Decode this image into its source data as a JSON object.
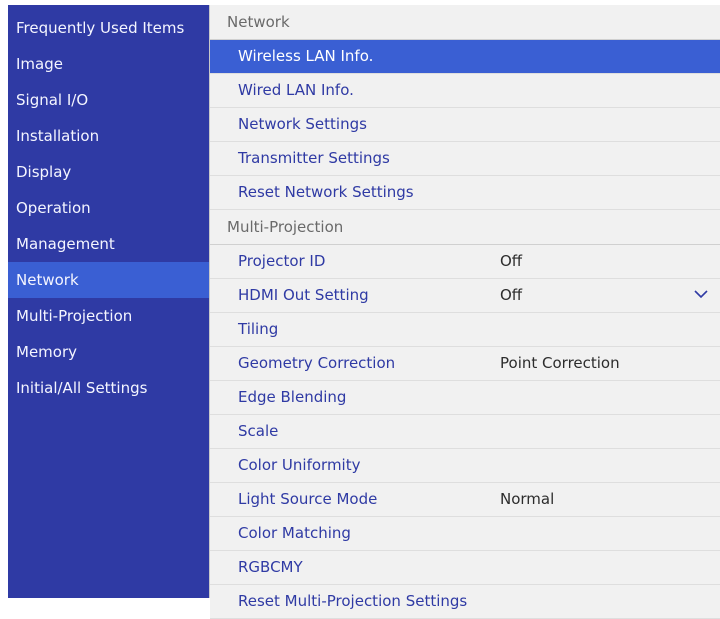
{
  "colors": {
    "sidebar_bg": "#2f3aa4",
    "highlight": "#3a5fd3",
    "item_text": "#2f3aa4",
    "value_text": "#2c2c2c",
    "section_text": "#6a6a6a"
  },
  "sidebar": {
    "items": [
      {
        "label": "Frequently Used Items"
      },
      {
        "label": "Image"
      },
      {
        "label": "Signal I/O"
      },
      {
        "label": "Installation"
      },
      {
        "label": "Display"
      },
      {
        "label": "Operation"
      },
      {
        "label": "Management"
      },
      {
        "label": "Network",
        "selected": true
      },
      {
        "label": "Multi-Projection"
      },
      {
        "label": "Memory"
      },
      {
        "label": "Initial/All Settings"
      }
    ]
  },
  "network": {
    "title": "Network",
    "items": [
      {
        "label": "Wireless LAN Info.",
        "selected": true
      },
      {
        "label": "Wired LAN Info."
      },
      {
        "label": "Network Settings"
      },
      {
        "label": "Transmitter Settings"
      },
      {
        "label": "Reset Network Settings"
      }
    ]
  },
  "multi_projection": {
    "title": "Multi-Projection",
    "items": [
      {
        "label": "Projector ID",
        "value": "Off"
      },
      {
        "label": "HDMI Out Setting",
        "value": "Off",
        "icon": "chevron-down-icon"
      },
      {
        "label": "Tiling"
      },
      {
        "label": "Geometry Correction",
        "value": "Point Correction"
      },
      {
        "label": "Edge Blending"
      },
      {
        "label": "Scale"
      },
      {
        "label": "Color Uniformity"
      },
      {
        "label": "Light Source Mode",
        "value": "Normal"
      },
      {
        "label": "Color Matching"
      },
      {
        "label": "RGBCMY"
      },
      {
        "label": "Reset Multi-Projection Settings"
      }
    ]
  }
}
